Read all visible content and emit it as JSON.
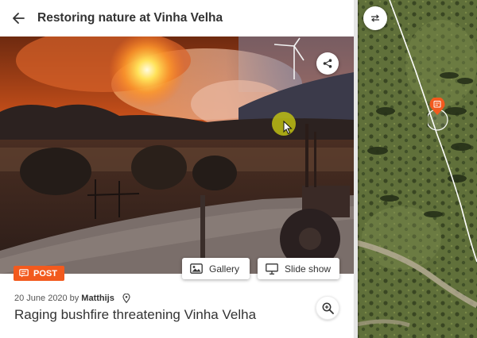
{
  "header": {
    "title": "Restoring nature at Vinha Velha",
    "back_icon": "arrow-left-icon"
  },
  "photo": {
    "alt_icon": "share-icon"
  },
  "badge": {
    "label": "POST",
    "color": "#f25a1e",
    "icon": "post-icon"
  },
  "actions": {
    "gallery_label": "Gallery",
    "slideshow_label": "Slide show"
  },
  "post": {
    "date": "20 June 2020",
    "by": "by",
    "author": "Matthijs",
    "title": "Raging bushfire threatening Vinha Velha"
  },
  "map": {
    "swap_icon": "swap-arrows-icon",
    "pin_icon": "map-pin-icon",
    "pin_color": "#f25a1e"
  }
}
